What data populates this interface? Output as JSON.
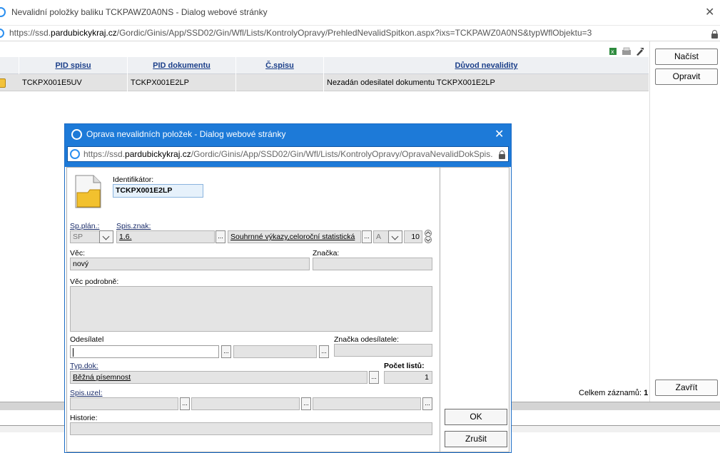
{
  "outer": {
    "title": "Nevalidní položky baliku TCKPAWZ0A0NS - Dialog webové stránky",
    "url_prefix": "https://ssd.",
    "url_domain": "pardubickykraj.cz",
    "url_path": "/Gordic/Ginis/App/SSD02/Gin/Wfl/Lists/KontrolyOpravy/PrehledNevalidSpitkon.aspx?ixs=TCKPAWZ0A0NS&typWflObjektu=3",
    "close": "✕"
  },
  "grid": {
    "columns": [
      "PID spisu",
      "PID dokumentu",
      "Č.spisu",
      "Důvod nevalidity"
    ],
    "rows": [
      [
        "TCKPX001E5UV",
        "TCKPX001E2LP",
        "",
        "Nezadán odesilatel dokumentu TCKPX001E2LP"
      ]
    ],
    "records_label": "Celkem záznamů:",
    "records_count": "1"
  },
  "side_buttons": {
    "load": "Načíst",
    "fix": "Opravit",
    "close": "Zavřít"
  },
  "dialog": {
    "title": "Oprava nevalidních položek - Dialog webové stránky",
    "url_prefix": "https://ssd.",
    "url_domain": "pardubickykraj.cz",
    "url_path": "/Gordic/Ginis/App/SSD02/Gin/Wfl/Lists/KontrolyOpravy/OpravaNevalidDokSpis.",
    "close": "✕",
    "identifier_label": "Identifikátor:",
    "identifier_value": "TCKPX001E2LP",
    "sp_plan_label": "Sp.plán.:",
    "sp_plan_value": "SP",
    "spis_znak_label": "Spis.znak:",
    "spis_znak_value": "1.6.",
    "spis_znak_desc": "Souhrnné výkazy,celoroční statistická",
    "skart_znak": "A",
    "skart_lhuta": "10",
    "vec_label": "Věc:",
    "vec_value": "nový",
    "znacka_label": "Značka:",
    "znacka_value": "",
    "vec_podrobne_label": "Věc podrobně:",
    "odesilatel_label": "Odesílatel",
    "znacka_odesilatele_label": "Značka odesílatele:",
    "typ_dok_label": "Typ.dok:",
    "typ_dok_value": "Běžná písemnost",
    "pocet_listu_label": "Počet listů:",
    "pocet_listu_value": "1",
    "spis_uzel_label": "Spis.uzel:",
    "historie_label": "Historie:",
    "ok": "OK",
    "cancel": "Zrušit",
    "dots": "..."
  }
}
